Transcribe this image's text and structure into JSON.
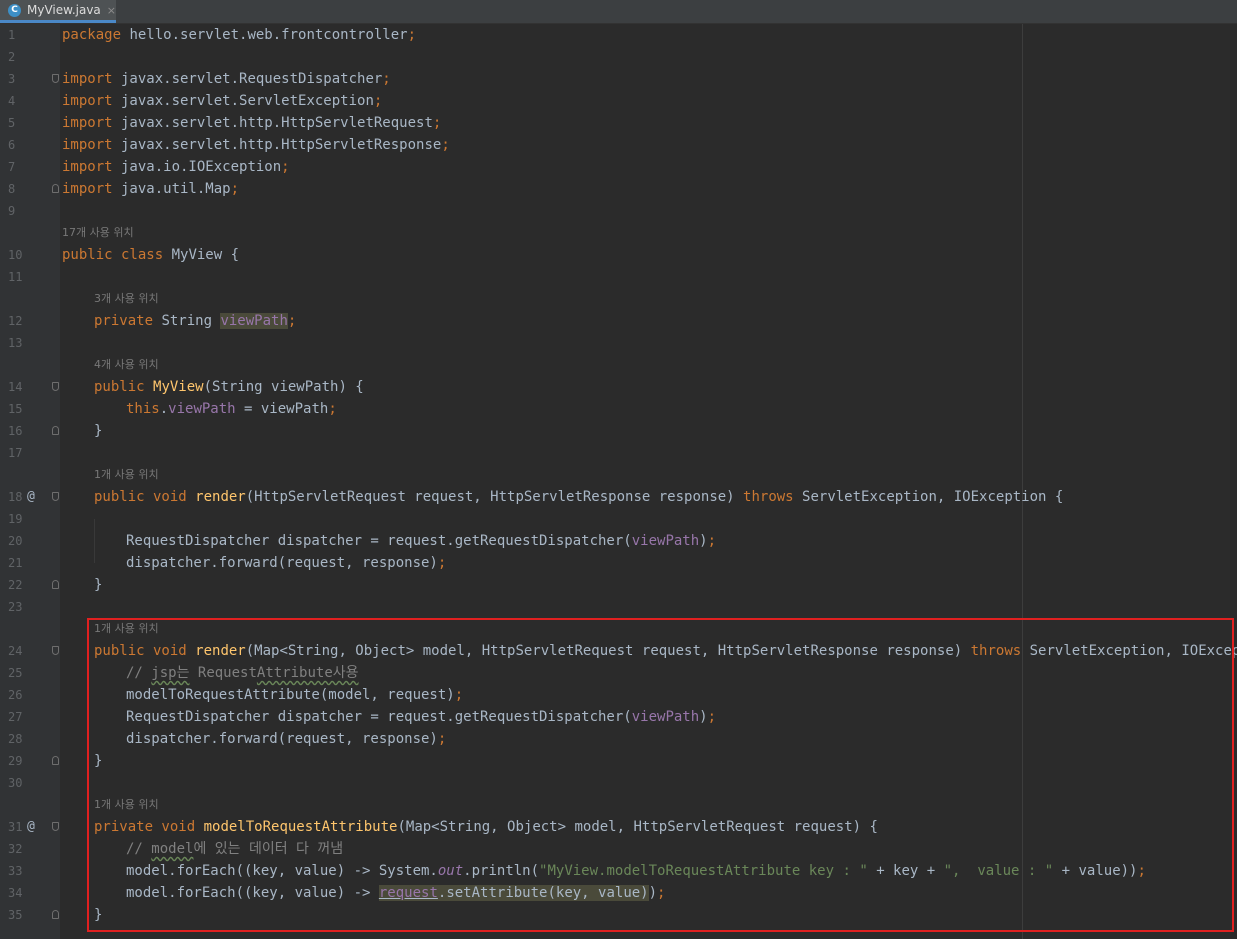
{
  "tab": {
    "icon": "java-class-icon",
    "filename": "MyView.java",
    "close": "×"
  },
  "line_numbers": [
    "1",
    "2",
    "3",
    "4",
    "5",
    "6",
    "7",
    "8",
    "9",
    "10",
    "11",
    "12",
    "13",
    "14",
    "15",
    "16",
    "17",
    "18",
    "19",
    "20",
    "21",
    "22",
    "23",
    "24",
    "25",
    "26",
    "27",
    "28",
    "29",
    "30",
    "31",
    "32",
    "33",
    "34",
    "35"
  ],
  "usage_hints": {
    "class": "17개 사용 위치",
    "field": "3개 사용 위치",
    "constructor": "4개 사용 위치",
    "render1": "1개 사용 위치",
    "render2": "1개 사용 위치",
    "model_to_request": "1개 사용 위치"
  },
  "code": {
    "l1_kw": "package",
    "l1_rest": " hello.servlet.web.frontcontroller",
    "semi": ";",
    "import_kw": "import",
    "l3": " javax.servlet.RequestDispatcher",
    "l4": " javax.servlet.ServletException",
    "l5": " javax.servlet.http.HttpServletRequest",
    "l6": " javax.servlet.http.HttpServletResponse",
    "l7": " java.io.IOException",
    "l8": " java.util.Map",
    "l10_kw": "public class",
    "l10_name": " MyView {",
    "l12_kw": "private",
    "l12_type": " String ",
    "l12_field": "viewPath",
    "l14_kw": "public",
    "l14_fn": "MyView",
    "l14_rest": "(String viewPath) {",
    "l15_kw": "this",
    "l15_dot": ".",
    "l15_field": "viewPath",
    "l15_rest": " = viewPath",
    "close_brace": "}",
    "l18_kw": "public void",
    "l18_fn": "render",
    "l18_rest": "(HttpServletRequest request, HttpServletResponse response) ",
    "throws": "throws",
    "l18_ex": " ServletException, IOException {",
    "l20_a": "RequestDispatcher dispatcher = request.getRequestDispatcher(",
    "l20_field": "viewPath",
    "l20_b": ")",
    "l21": "dispatcher.forward(request, response)",
    "l24_fn": "render",
    "l24_a": "(Map<String, Object> model, HttpServletRequest request, HttpServletResponse response) ",
    "l25_c1": "// ",
    "l25_jsp": "jsp는",
    "l25_c2": " Request",
    "l25_attr": "Attribute사용",
    "l26": "modelToRequestAttribute(model, request)",
    "l31_kw": "private void",
    "l31_fn": "modelToRequestAttribute",
    "l31_rest": "(Map<String, Object> model, HttpServletRequest request) {",
    "l32_c1": "// ",
    "l32_model": "model",
    "l32_c2": "에 있는 데이터 다 꺼냄",
    "l33_a": "model.forEach((key, value) -> System.",
    "l33_out": "out",
    "l33_b": ".println(",
    "l33_s1": "\"MyView.modelToRequestAttribute key : \"",
    "l33_c": " + key + ",
    "l33_s2": "\",  value : \"",
    "l33_d": " + value))",
    "l34_a": "model.forEach((key, value) -> ",
    "l34_req": "request",
    "l34_b": ".setAttribute(key, value)",
    "l34_c": ")"
  }
}
